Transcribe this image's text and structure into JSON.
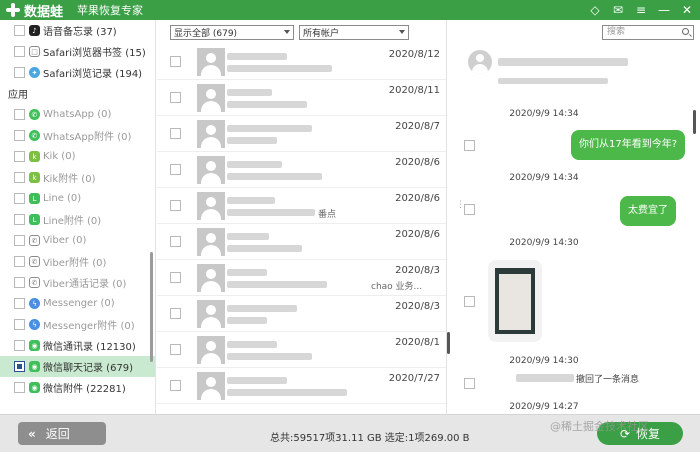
{
  "titlebar": {
    "app_name": "数据蛙",
    "subtitle": "苹果恢复专家"
  },
  "sidebar": {
    "top_items": [
      {
        "label": "语音备忘录 (37)",
        "color": "#222222"
      },
      {
        "label": "Safari浏览器书签 (15)",
        "color": "#888888"
      },
      {
        "label": "Safari浏览记录 (194)",
        "color": "#4aa6e0"
      }
    ],
    "section_label": "应用",
    "app_items": [
      {
        "label": "WhatsApp (0)",
        "color": "#3fbf5a"
      },
      {
        "label": "WhatsApp附件 (0)",
        "color": "#3fbf5a"
      },
      {
        "label": "Kik (0)",
        "color": "#7bc043"
      },
      {
        "label": "Kik附件 (0)",
        "color": "#7bc043"
      },
      {
        "label": "Line (0)",
        "color": "#3fbf5a"
      },
      {
        "label": "Line附件 (0)",
        "color": "#3fbf5a"
      },
      {
        "label": "Viber (0)",
        "color": "#8a8a8a"
      },
      {
        "label": "Viber附件 (0)",
        "color": "#8a8a8a"
      },
      {
        "label": "Viber通话记录 (0)",
        "color": "#8a8a8a"
      },
      {
        "label": "Messenger (0)",
        "color": "#4a8fe0"
      },
      {
        "label": "Messenger附件 (0)",
        "color": "#4a8fe0"
      },
      {
        "label": "微信通讯录 (12130)",
        "color": "#3fbf5a"
      },
      {
        "label": "微信聊天记录 (679)",
        "color": "#3fbf5a"
      },
      {
        "label": "微信附件 (22281)",
        "color": "#3fbf5a"
      }
    ]
  },
  "filters": {
    "show_all": "显示全部 (679)",
    "account": "所有帐户"
  },
  "messages": [
    {
      "date": "2020/8/12",
      "snippet": ""
    },
    {
      "date": "2020/8/11",
      "snippet": ""
    },
    {
      "date": "2020/8/7",
      "snippet": ""
    },
    {
      "date": "2020/8/6",
      "snippet": ""
    },
    {
      "date": "2020/8/6",
      "snippet": "番点"
    },
    {
      "date": "2020/8/6",
      "snippet": ""
    },
    {
      "date": "2020/8/3",
      "snippet": "chao 业务..."
    },
    {
      "date": "2020/8/3",
      "snippet": ""
    },
    {
      "date": "2020/8/1",
      "snippet": ""
    },
    {
      "date": "2020/7/27",
      "snippet": ""
    }
  ],
  "search": {
    "placeholder": "搜索"
  },
  "chat": {
    "timestamps": [
      "2020/9/9 14:34",
      "2020/9/9 14:34",
      "2020/9/9 14:30",
      "2020/9/9 14:30",
      "2020/9/9 14:27"
    ],
    "bubble_1": "你们从17年看到今年?",
    "bubble_2": "太费宜了",
    "recall_text": "撤回了一条消息"
  },
  "bottombar": {
    "back_label": "返回",
    "summary": "总共:59517项31.11 GB 选定:1项269.00 B",
    "recover_label": "恢复"
  },
  "watermark": "@稀土掘金技术社区"
}
